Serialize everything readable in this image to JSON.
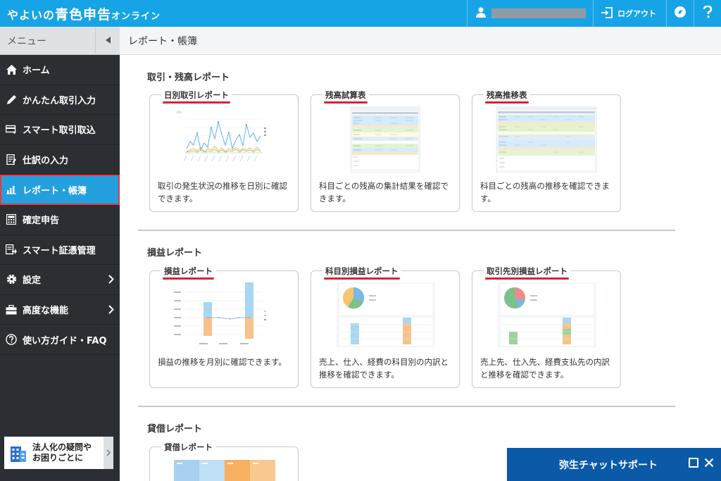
{
  "header": {
    "logo_prefix": "やよいの",
    "logo_main": "青色申告",
    "logo_suffix": "オンライン",
    "logout_label": "ログアウト"
  },
  "menu": {
    "title": "メニュー",
    "items": [
      {
        "label": "ホーム",
        "icon": "home-icon"
      },
      {
        "label": "かんたん取引入力",
        "icon": "pencil-icon"
      },
      {
        "label": "スマート取引取込",
        "icon": "card-import-icon"
      },
      {
        "label": "仕訳の入力",
        "icon": "journal-icon"
      },
      {
        "label": "レポート・帳簿",
        "icon": "report-chart-icon"
      },
      {
        "label": "確定申告",
        "icon": "calculator-icon"
      },
      {
        "label": "スマート証憑管理",
        "icon": "document-upload-icon"
      },
      {
        "label": "設定",
        "icon": "gear-icon"
      },
      {
        "label": "高度な機能",
        "icon": "toolbox-icon"
      },
      {
        "label": "使い方ガイド・FAQ",
        "icon": "help-circle-icon"
      }
    ],
    "active_index": 4,
    "corp_banner": {
      "line1": "法人化の疑問や",
      "line2": "お困りごとに"
    }
  },
  "page_title": "レポート・帳簿",
  "sections": [
    {
      "title": "取引・残高レポート",
      "cards": [
        {
          "title": "日別取引レポート",
          "desc": "取引の発生状況の推移を日別に確認できます。"
        },
        {
          "title": "残高試算表",
          "desc": "科目ごとの残高の集計結果を確認できます。"
        },
        {
          "title": "残高推移表",
          "desc": "科目ごとの残高の推移を確認できます。"
        }
      ]
    },
    {
      "title": "損益レポート",
      "cards": [
        {
          "title": "損益レポート",
          "desc": "損益の推移を月別に確認できます。"
        },
        {
          "title": "科目別損益レポート",
          "desc": "売上、仕入、経費の科目別の内訳と推移を確認できます。"
        },
        {
          "title": "取引先別損益レポート",
          "desc": "売上先、仕入先、経費支払先の内訳と推移を確認できます。"
        }
      ]
    },
    {
      "title": "貸借レポート",
      "cards": [
        {
          "title": "貸借レポート",
          "desc": ""
        }
      ]
    }
  ],
  "chat": {
    "label": "弥生チャットサポート"
  },
  "colors": {
    "header": "#16a4e6",
    "sidebar": "#2b2f33",
    "active": "#25a0de",
    "highlight": "#e63a3a",
    "underline": "#d8213a",
    "chat": "#0b5aa8"
  }
}
